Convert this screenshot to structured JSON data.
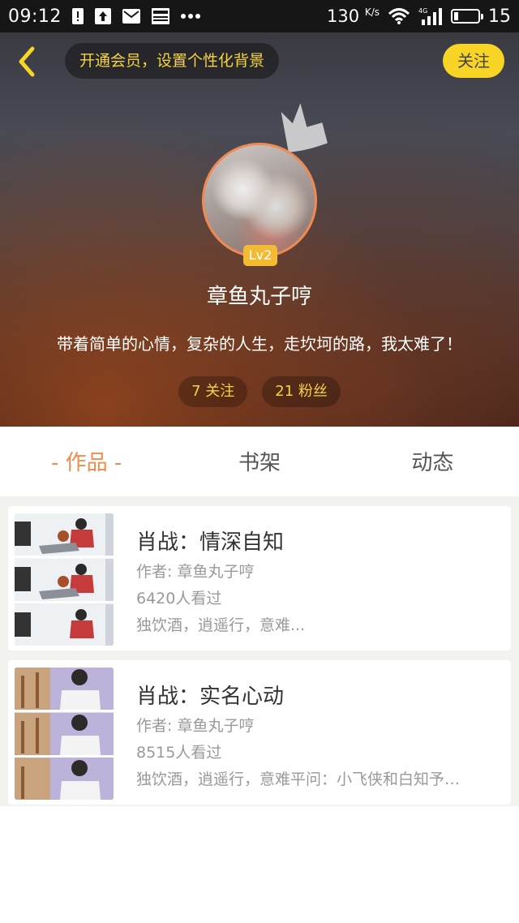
{
  "status_bar": {
    "time": "09:12",
    "network_speed": "130",
    "network_speed_unit": "K/s",
    "signal_type": "4G",
    "battery": "15",
    "icons": [
      "alert-icon",
      "upload-icon",
      "mail-icon",
      "news-icon",
      "more-dots-icon",
      "wifi-icon",
      "signal-icon",
      "battery-icon"
    ]
  },
  "header": {
    "vip_prompt": "开通会员，设置个性化背景",
    "follow_label": "关注",
    "level": "Lv2",
    "username": "章鱼丸子哼",
    "bio": "带着简单的心情，复杂的人生，走坎坷的路，我太难了！",
    "following_label": "7 关注",
    "followers_label": "21 粉丝"
  },
  "colors": {
    "accent_orange": "#f28a4a",
    "accent_yellow": "#f7d426",
    "vip_text": "#f5d33f"
  },
  "tabs": [
    {
      "label": "- 作品 -",
      "active": true
    },
    {
      "label": "书架",
      "active": false
    },
    {
      "label": "动态",
      "active": false
    }
  ],
  "works": [
    {
      "title": "肖战：情深自知",
      "author": "作者: 章鱼丸子哼",
      "views": "6420人看过",
      "description": "独饮酒，逍遥行，意难..."
    },
    {
      "title": "肖战：实名心动",
      "author": "作者: 章鱼丸子哼",
      "views": "8515人看过",
      "description": "独饮酒，逍遥行，意难平问：小飞侠和白知予…"
    }
  ]
}
